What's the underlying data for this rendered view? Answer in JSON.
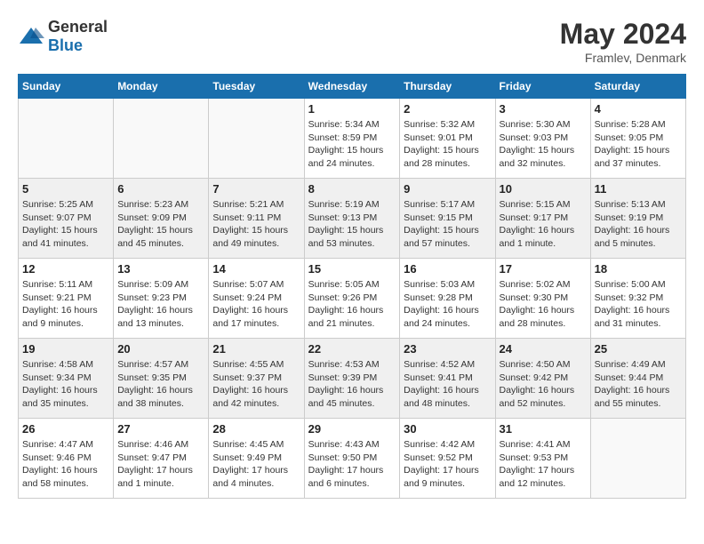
{
  "header": {
    "logo_general": "General",
    "logo_blue": "Blue",
    "month_year": "May 2024",
    "location": "Framlev, Denmark"
  },
  "days_of_week": [
    "Sunday",
    "Monday",
    "Tuesday",
    "Wednesday",
    "Thursday",
    "Friday",
    "Saturday"
  ],
  "weeks": [
    [
      {
        "day": "",
        "info": ""
      },
      {
        "day": "",
        "info": ""
      },
      {
        "day": "",
        "info": ""
      },
      {
        "day": "1",
        "info": "Sunrise: 5:34 AM\nSunset: 8:59 PM\nDaylight: 15 hours\nand 24 minutes."
      },
      {
        "day": "2",
        "info": "Sunrise: 5:32 AM\nSunset: 9:01 PM\nDaylight: 15 hours\nand 28 minutes."
      },
      {
        "day": "3",
        "info": "Sunrise: 5:30 AM\nSunset: 9:03 PM\nDaylight: 15 hours\nand 32 minutes."
      },
      {
        "day": "4",
        "info": "Sunrise: 5:28 AM\nSunset: 9:05 PM\nDaylight: 15 hours\nand 37 minutes."
      }
    ],
    [
      {
        "day": "5",
        "info": "Sunrise: 5:25 AM\nSunset: 9:07 PM\nDaylight: 15 hours\nand 41 minutes."
      },
      {
        "day": "6",
        "info": "Sunrise: 5:23 AM\nSunset: 9:09 PM\nDaylight: 15 hours\nand 45 minutes."
      },
      {
        "day": "7",
        "info": "Sunrise: 5:21 AM\nSunset: 9:11 PM\nDaylight: 15 hours\nand 49 minutes."
      },
      {
        "day": "8",
        "info": "Sunrise: 5:19 AM\nSunset: 9:13 PM\nDaylight: 15 hours\nand 53 minutes."
      },
      {
        "day": "9",
        "info": "Sunrise: 5:17 AM\nSunset: 9:15 PM\nDaylight: 15 hours\nand 57 minutes."
      },
      {
        "day": "10",
        "info": "Sunrise: 5:15 AM\nSunset: 9:17 PM\nDaylight: 16 hours\nand 1 minute."
      },
      {
        "day": "11",
        "info": "Sunrise: 5:13 AM\nSunset: 9:19 PM\nDaylight: 16 hours\nand 5 minutes."
      }
    ],
    [
      {
        "day": "12",
        "info": "Sunrise: 5:11 AM\nSunset: 9:21 PM\nDaylight: 16 hours\nand 9 minutes."
      },
      {
        "day": "13",
        "info": "Sunrise: 5:09 AM\nSunset: 9:23 PM\nDaylight: 16 hours\nand 13 minutes."
      },
      {
        "day": "14",
        "info": "Sunrise: 5:07 AM\nSunset: 9:24 PM\nDaylight: 16 hours\nand 17 minutes."
      },
      {
        "day": "15",
        "info": "Sunrise: 5:05 AM\nSunset: 9:26 PM\nDaylight: 16 hours\nand 21 minutes."
      },
      {
        "day": "16",
        "info": "Sunrise: 5:03 AM\nSunset: 9:28 PM\nDaylight: 16 hours\nand 24 minutes."
      },
      {
        "day": "17",
        "info": "Sunrise: 5:02 AM\nSunset: 9:30 PM\nDaylight: 16 hours\nand 28 minutes."
      },
      {
        "day": "18",
        "info": "Sunrise: 5:00 AM\nSunset: 9:32 PM\nDaylight: 16 hours\nand 31 minutes."
      }
    ],
    [
      {
        "day": "19",
        "info": "Sunrise: 4:58 AM\nSunset: 9:34 PM\nDaylight: 16 hours\nand 35 minutes."
      },
      {
        "day": "20",
        "info": "Sunrise: 4:57 AM\nSunset: 9:35 PM\nDaylight: 16 hours\nand 38 minutes."
      },
      {
        "day": "21",
        "info": "Sunrise: 4:55 AM\nSunset: 9:37 PM\nDaylight: 16 hours\nand 42 minutes."
      },
      {
        "day": "22",
        "info": "Sunrise: 4:53 AM\nSunset: 9:39 PM\nDaylight: 16 hours\nand 45 minutes."
      },
      {
        "day": "23",
        "info": "Sunrise: 4:52 AM\nSunset: 9:41 PM\nDaylight: 16 hours\nand 48 minutes."
      },
      {
        "day": "24",
        "info": "Sunrise: 4:50 AM\nSunset: 9:42 PM\nDaylight: 16 hours\nand 52 minutes."
      },
      {
        "day": "25",
        "info": "Sunrise: 4:49 AM\nSunset: 9:44 PM\nDaylight: 16 hours\nand 55 minutes."
      }
    ],
    [
      {
        "day": "26",
        "info": "Sunrise: 4:47 AM\nSunset: 9:46 PM\nDaylight: 16 hours\nand 58 minutes."
      },
      {
        "day": "27",
        "info": "Sunrise: 4:46 AM\nSunset: 9:47 PM\nDaylight: 17 hours\nand 1 minute."
      },
      {
        "day": "28",
        "info": "Sunrise: 4:45 AM\nSunset: 9:49 PM\nDaylight: 17 hours\nand 4 minutes."
      },
      {
        "day": "29",
        "info": "Sunrise: 4:43 AM\nSunset: 9:50 PM\nDaylight: 17 hours\nand 6 minutes."
      },
      {
        "day": "30",
        "info": "Sunrise: 4:42 AM\nSunset: 9:52 PM\nDaylight: 17 hours\nand 9 minutes."
      },
      {
        "day": "31",
        "info": "Sunrise: 4:41 AM\nSunset: 9:53 PM\nDaylight: 17 hours\nand 12 minutes."
      },
      {
        "day": "",
        "info": ""
      }
    ]
  ]
}
